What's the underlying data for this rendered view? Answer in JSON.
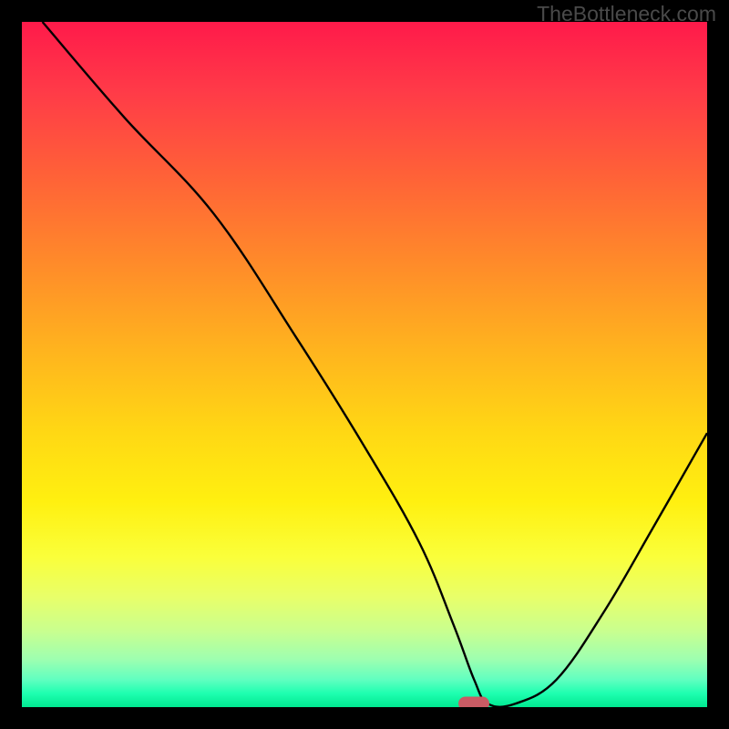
{
  "watermark": "TheBottleneck.com",
  "chart_data": {
    "type": "line",
    "title": "",
    "xlabel": "",
    "ylabel": "",
    "xlim": [
      0,
      100
    ],
    "ylim": [
      0,
      100
    ],
    "x": [
      3,
      15,
      28,
      40,
      50,
      58,
      63,
      66,
      68,
      72,
      78,
      85,
      92,
      100
    ],
    "values": [
      100,
      86,
      72,
      54,
      38,
      24,
      12,
      4,
      0.5,
      0.5,
      4,
      14,
      26,
      40
    ],
    "marker": {
      "x": 66,
      "y": 0.5
    },
    "gradient_stops": [
      {
        "pos": 0,
        "color": "#ff1a4a"
      },
      {
        "pos": 50,
        "color": "#ffc818"
      },
      {
        "pos": 80,
        "color": "#fcff40"
      },
      {
        "pos": 100,
        "color": "#00e890"
      }
    ]
  }
}
